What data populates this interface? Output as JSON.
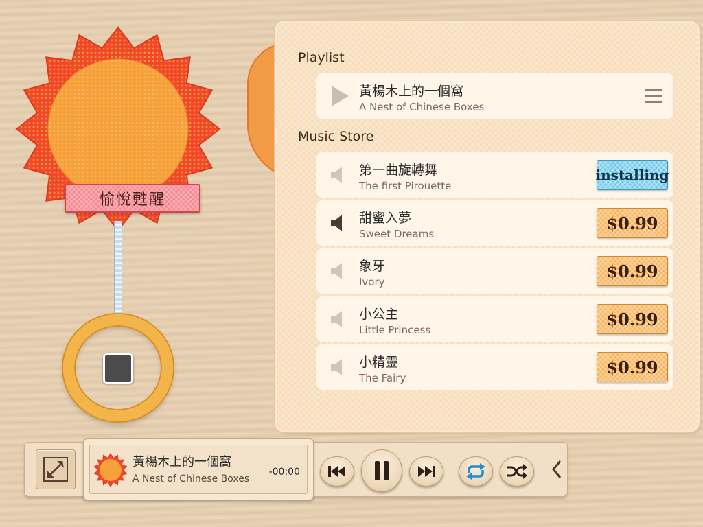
{
  "sun_widget": {
    "label": "愉悅甦醒"
  },
  "playlist": {
    "title": "Playlist",
    "items": [
      {
        "title": "黃楊木上的一個窩",
        "subtitle": "A Nest of Chinese Boxes"
      }
    ]
  },
  "store": {
    "title": "Music Store",
    "items": [
      {
        "title": "第一曲旋轉舞",
        "subtitle": "The first Pirouette",
        "action": "installing"
      },
      {
        "title": "甜蜜入夢",
        "subtitle": "Sweet Dreams",
        "action": "$0.99"
      },
      {
        "title": "象牙",
        "subtitle": "Ivory",
        "action": "$0.99"
      },
      {
        "title": "小公主",
        "subtitle": "Little Princess",
        "action": "$0.99"
      },
      {
        "title": "小精靈",
        "subtitle": "The Fairy",
        "action": "$0.99"
      }
    ]
  },
  "player": {
    "title": "黃楊木上的一個窩",
    "subtitle": "A Nest of Chinese Boxes",
    "time": "-00:00"
  },
  "icons": {
    "expand": "expand-icon",
    "play": "play-icon",
    "menu": "menu-icon",
    "speaker": "speaker-icon",
    "prev": "skip-previous-icon",
    "pause": "pause-icon",
    "next": "skip-next-icon",
    "repeat": "repeat-icon",
    "shuffle": "shuffle-icon",
    "collapse": "chevron-left-icon",
    "stop": "stop-icon"
  },
  "colors": {
    "sun_outer": "#f2482a",
    "sun_inner": "#f7a13d",
    "label_bg": "#f6868e",
    "panel_bg": "#fbe7cd",
    "price_bg": "#f8b45c",
    "installing_bg": "#6dc8ea",
    "repeat_accent": "#1e8fd0"
  }
}
